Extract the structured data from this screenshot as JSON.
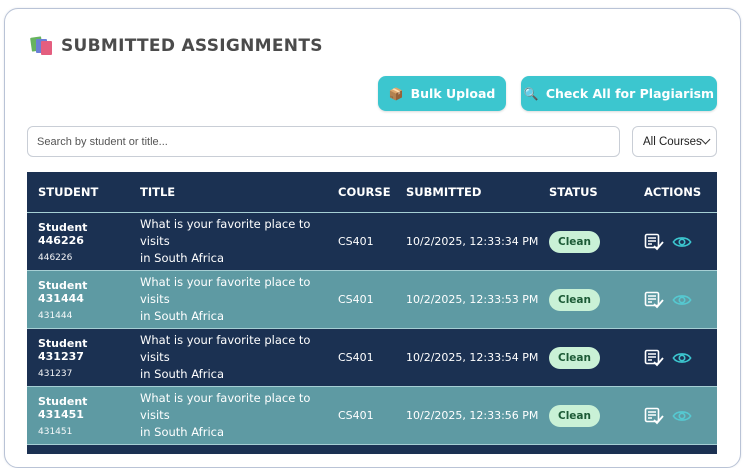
{
  "header": {
    "title": "SUBMITTED ASSIGNMENTS",
    "icon": "books-icon"
  },
  "toolbar": {
    "bulk_upload_label": "Bulk Upload",
    "bulk_upload_icon": "package-icon",
    "check_all_label": "Check All for Plagiarism",
    "check_all_icon": "magnifier-icon",
    "accent_color": "#3cc6cf"
  },
  "filters": {
    "search_placeholder": "Search by student or title...",
    "course_select_value": "All Courses"
  },
  "table": {
    "columns": [
      "STUDENT",
      "TITLE",
      "COURSE",
      "SUBMITTED",
      "STATUS",
      "ACTIONS"
    ],
    "header_color": "#1b3152",
    "rows": [
      {
        "student": "Student 446226",
        "student_id": "446226",
        "title_line1": "What is your favorite place to visits",
        "title_line2": "in South Africa",
        "course": "CS401",
        "submitted": "10/2/2025, 12:33:34 PM",
        "status": "Clean"
      },
      {
        "student": "Student 431444",
        "student_id": "431444",
        "title_line1": "What is your favorite place to visits",
        "title_line2": "in South Africa",
        "course": "CS401",
        "submitted": "10/2/2025, 12:33:53 PM",
        "status": "Clean"
      },
      {
        "student": "Student 431237",
        "student_id": "431237",
        "title_line1": "What is your favorite place to visits",
        "title_line2": "in South Africa",
        "course": "CS401",
        "submitted": "10/2/2025, 12:33:54 PM",
        "status": "Clean"
      },
      {
        "student": "Student 431451",
        "student_id": "431451",
        "title_line1": "What is your favorite place to visits",
        "title_line2": "in South Africa",
        "course": "CS401",
        "submitted": "10/2/2025, 12:33:56 PM",
        "status": "Clean"
      }
    ]
  }
}
